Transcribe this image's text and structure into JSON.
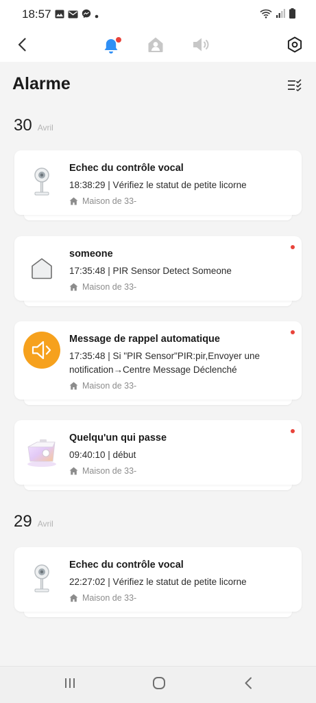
{
  "status_bar": {
    "time": "18:57",
    "icons": [
      "gallery-icon",
      "mail-icon",
      "messenger-icon",
      "dot-icon",
      "wifi-icon",
      "signal-icon",
      "battery-icon"
    ]
  },
  "app_bar": {
    "icons": [
      "back-icon",
      "bell-icon",
      "home-person-icon",
      "speaker-icon",
      "settings-icon"
    ],
    "bell_has_badge": true,
    "accent_color": "#2f8ff5",
    "badge_color": "#e8433a"
  },
  "page": {
    "title": "Alarme",
    "filter_icon": "filter-list-icon"
  },
  "groups": [
    {
      "day": "30",
      "month": "Avril",
      "items": [
        {
          "title": "Echec du contrôle vocal",
          "description": "18:38:29 | Vérifiez le statut de petite licorne",
          "home": "Maison de 33-",
          "thumb": "camera-icon",
          "unread": false
        },
        {
          "title": "someone",
          "description": "17:35:48 | PIR Sensor Detect Someone",
          "home": "Maison de 33-",
          "thumb": "house-icon",
          "unread": true
        },
        {
          "title": "Message de rappel automatique",
          "description": "17:35:48 | Si \"PIR Sensor\"PIR:pir,Envoyer une notification→Centre Message Déclenché",
          "home": "Maison de 33-",
          "thumb": "speaker-icon",
          "unread": true
        },
        {
          "title": "Quelqu'un qui passe",
          "description": "09:40:10 | début",
          "home": "Maison de 33-",
          "thumb": "lamp-device-icon",
          "unread": true
        }
      ]
    },
    {
      "day": "29",
      "month": "Avril",
      "items": [
        {
          "title": "Echec du contrôle vocal",
          "description": "22:27:02 | Vérifiez le statut de petite licorne",
          "home": "Maison de 33-",
          "thumb": "camera-icon",
          "unread": false
        }
      ]
    }
  ],
  "nav_bar": {
    "icons": [
      "recent-apps-icon",
      "home-button-icon",
      "back-button-icon"
    ]
  }
}
